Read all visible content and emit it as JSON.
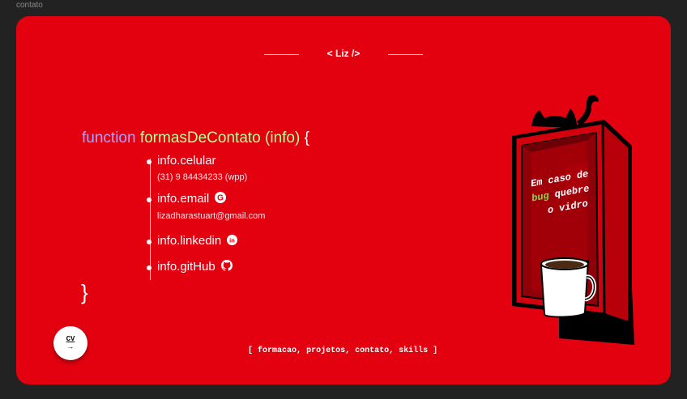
{
  "page": {
    "label": "contato"
  },
  "logo": {
    "text": "< Liz />"
  },
  "code": {
    "keyword": "function",
    "function_name": "formasDeContato",
    "param": "(info)",
    "open_brace": "{",
    "close_brace": "}"
  },
  "contacts": [
    {
      "title": "info.celular",
      "detail": "(31) 9 84434233 (wpp)",
      "icon": ""
    },
    {
      "title": "info.email",
      "detail": "lizadharastuart@gmail.com",
      "icon": "google-icon"
    },
    {
      "title": "info.linkedin",
      "detail": "",
      "icon": "linkedin-icon"
    },
    {
      "title": "info.gitHub",
      "detail": "",
      "icon": "github-icon"
    }
  ],
  "cv_button": {
    "label": "CV",
    "arrow": "→"
  },
  "nav": {
    "open": "[",
    "close": "]",
    "items": [
      "formacao",
      "projetos",
      "contato",
      "skills"
    ]
  },
  "illustration": {
    "line1_pre": "Em caso de",
    "line2_highlight": "bug",
    "line2_rest": "quebre",
    "line3": "o vidro",
    "highlight_color": "#8bd64f"
  },
  "colors": {
    "card": "#e3000f",
    "background": "#222222",
    "keyword": "#a9a3ff",
    "function": "#b6ff9b"
  }
}
